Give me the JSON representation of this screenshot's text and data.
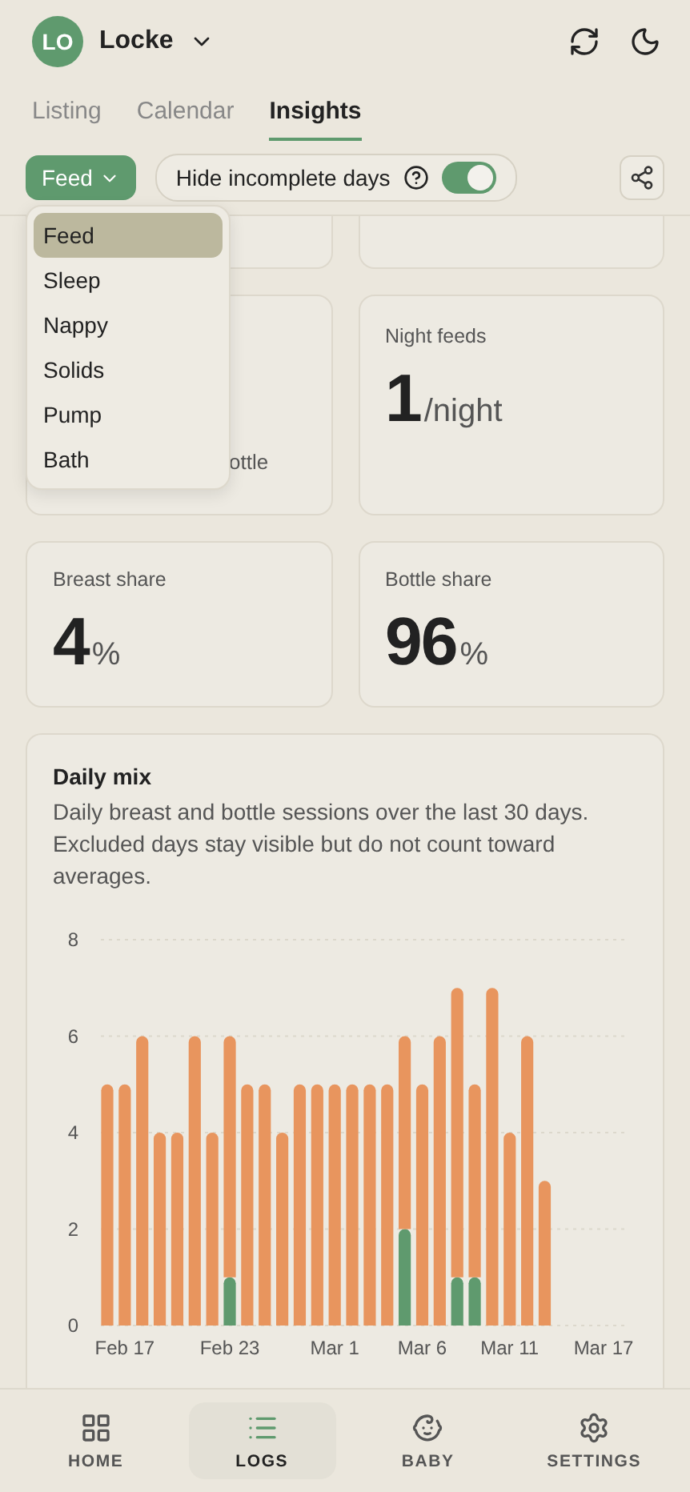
{
  "header": {
    "avatar_initials": "LO",
    "profile_name": "Locke"
  },
  "tabs": [
    {
      "label": "Listing",
      "selected": false
    },
    {
      "label": "Calendar",
      "selected": false
    },
    {
      "label": "Insights",
      "selected": true
    }
  ],
  "toolbar": {
    "category": {
      "label": "Feed",
      "expanded": true,
      "options": [
        {
          "label": "Feed",
          "selected": true
        },
        {
          "label": "Sleep",
          "selected": false
        },
        {
          "label": "Nappy",
          "selected": false
        },
        {
          "label": "Solids",
          "selected": false
        },
        {
          "label": "Pump",
          "selected": false
        },
        {
          "label": "Bath",
          "selected": false
        }
      ]
    },
    "hide_incomplete": {
      "label": "Hide incomplete days",
      "on": true
    }
  },
  "partial_card_text": "ottle",
  "stats": [
    {
      "label": "Night feeds",
      "value": "1",
      "unit": "/night"
    },
    {
      "label": "Breast share",
      "value": "4",
      "unit": "%"
    },
    {
      "label": "Bottle share",
      "value": "96",
      "unit": "%"
    }
  ],
  "daily_mix": {
    "title": "Daily mix",
    "description": "Daily breast and bottle sessions over the last 30 days. Excluded days stay visible but do not count toward averages.",
    "chart_data": {
      "type": "bar",
      "stacked": true,
      "grid": true,
      "categories": [
        null,
        "Feb 17",
        null,
        null,
        null,
        null,
        null,
        "Feb 23",
        null,
        null,
        null,
        null,
        null,
        "Mar 1",
        null,
        null,
        null,
        null,
        "Mar 6",
        null,
        null,
        null,
        null,
        "Mar 11",
        null,
        null,
        null,
        null,
        null,
        "Mar 17"
      ],
      "series": [
        {
          "color": "#5f9a6e",
          "values": [
            0,
            0,
            0,
            0,
            0,
            0,
            0,
            1,
            0,
            0,
            0,
            0,
            0,
            0,
            0,
            0,
            0,
            2,
            0,
            0,
            1,
            1,
            0,
            0,
            0,
            0,
            null,
            null,
            null,
            null
          ]
        },
        {
          "color": "#e8955e",
          "values": [
            5,
            5,
            6,
            4,
            4,
            6,
            4,
            5,
            5,
            5,
            4,
            5,
            5,
            5,
            5,
            5,
            5,
            4,
            5,
            6,
            6,
            4,
            7,
            4,
            6,
            3,
            null,
            null,
            null,
            null
          ]
        }
      ],
      "ylim": [
        0,
        8
      ],
      "yticks": [
        0,
        2,
        4,
        6,
        8
      ]
    }
  },
  "nav": [
    {
      "label": "HOME",
      "selected": false
    },
    {
      "label": "LOGS",
      "selected": true
    },
    {
      "label": "BABY",
      "selected": false
    },
    {
      "label": "SETTINGS",
      "selected": false
    }
  ]
}
